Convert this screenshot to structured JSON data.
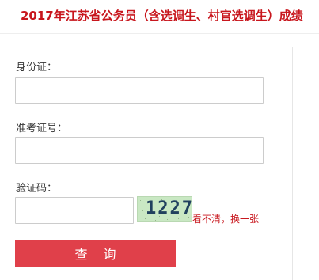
{
  "header": {
    "title": "2017年江苏省公务员（含选调生、村官选调生）成绩"
  },
  "form": {
    "id_label": "身份证：",
    "id_value": "",
    "exam_no_label": "准考证号：",
    "exam_no_value": "",
    "captcha_label": "验证码：",
    "captcha_value": "",
    "captcha_image_text": "1227",
    "refresh_captcha_label": "看不清，换一张",
    "submit_label": "查询"
  },
  "colors": {
    "title": "#c8161d",
    "button_bg": "#e0404a",
    "captcha_bg": "#c9e8c3",
    "link": "#c8161d"
  }
}
